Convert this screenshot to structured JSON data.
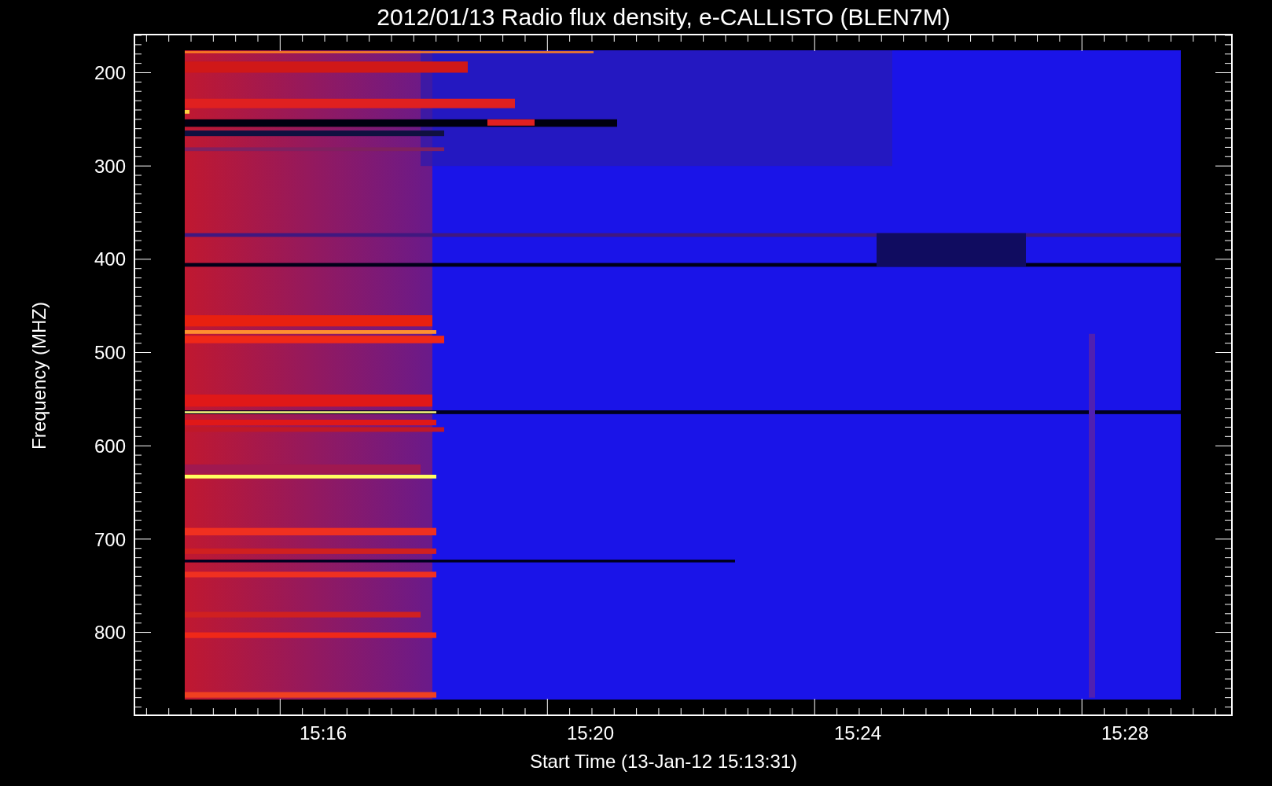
{
  "title": "2012/01/13  Radio flux density, e-CALLISTO (BLEN7M)",
  "y_axis": {
    "title": "Frequency (MHZ)",
    "ticks": [
      "200",
      "300",
      "400",
      "500",
      "600",
      "700",
      "800"
    ]
  },
  "x_axis": {
    "title": "Start Time (13-Jan-12 15:13:31)",
    "ticks": [
      "15:16",
      "15:20",
      "15:24",
      "15:28"
    ]
  }
}
